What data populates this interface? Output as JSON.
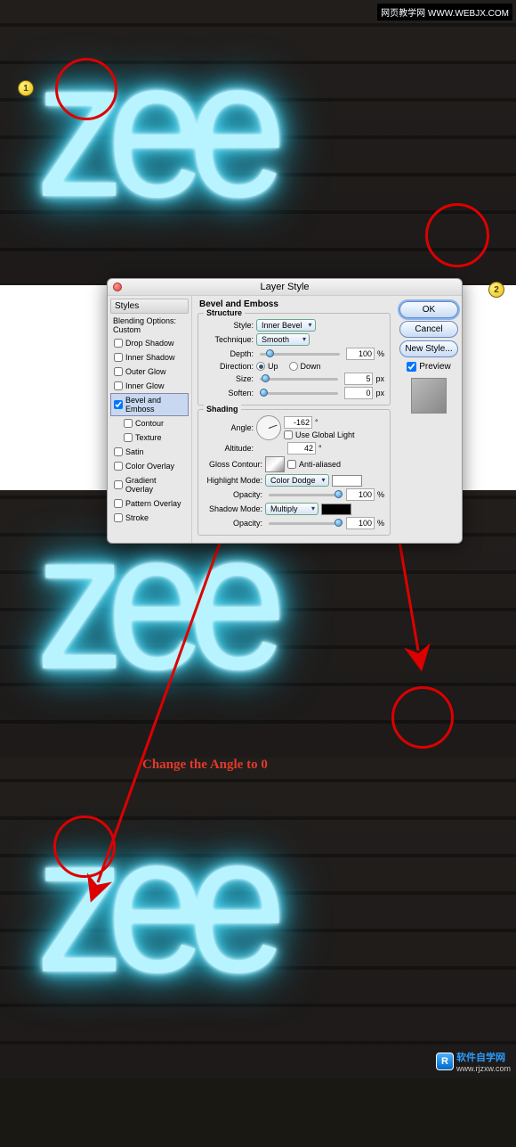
{
  "watermarks": {
    "top": "网页教学网\nWWW.WEBJX.COM",
    "bottom_cn": "软件自学网",
    "bottom_url": "www.rjzxw.com",
    "bottom_logo": "R"
  },
  "neon": "zee",
  "badges": {
    "one": "1",
    "two": "2"
  },
  "annotation": "Change the Angle to 0",
  "dialog": {
    "title": "Layer Style",
    "buttons": {
      "ok": "OK",
      "cancel": "Cancel",
      "new_style": "New Style...",
      "preview": "Preview"
    },
    "styles_head": "Styles",
    "blending_opts": "Blending Options: Custom",
    "style_list": [
      {
        "label": "Drop Shadow",
        "checked": false
      },
      {
        "label": "Inner Shadow",
        "checked": false
      },
      {
        "label": "Outer Glow",
        "checked": false
      },
      {
        "label": "Inner Glow",
        "checked": false
      },
      {
        "label": "Bevel and Emboss",
        "checked": true,
        "active": true
      },
      {
        "label": "Contour",
        "checked": false,
        "sub": true
      },
      {
        "label": "Texture",
        "checked": false,
        "sub": true
      },
      {
        "label": "Satin",
        "checked": false
      },
      {
        "label": "Color Overlay",
        "checked": false
      },
      {
        "label": "Gradient Overlay",
        "checked": false
      },
      {
        "label": "Pattern Overlay",
        "checked": false
      },
      {
        "label": "Stroke",
        "checked": false
      }
    ],
    "main_title": "Bevel and Emboss",
    "groups": {
      "structure": {
        "title": "Structure",
        "style_label": "Style:",
        "style_val": "Inner Bevel",
        "technique_label": "Technique:",
        "technique_val": "Smooth",
        "depth_label": "Depth:",
        "depth_val": "100",
        "depth_unit": "%",
        "direction_label": "Direction:",
        "up": "Up",
        "down": "Down",
        "size_label": "Size:",
        "size_val": "5",
        "size_unit": "px",
        "soften_label": "Soften:",
        "soften_val": "0",
        "soften_unit": "px"
      },
      "shading": {
        "title": "Shading",
        "angle_label": "Angle:",
        "angle_val": "-162",
        "deg": "°",
        "global_light": "Use Global Light",
        "altitude_label": "Altitude:",
        "altitude_val": "42",
        "gloss_label": "Gloss Contour:",
        "anti_alias": "Anti-aliased",
        "hl_mode_label": "Highlight Mode:",
        "hl_mode_val": "Color Dodge",
        "hl_opacity_label": "Opacity:",
        "hl_opacity_val": "100",
        "pct": "%",
        "sh_mode_label": "Shadow Mode:",
        "sh_mode_val": "Multiply",
        "sh_opacity_label": "Opacity:",
        "sh_opacity_val": "100"
      }
    }
  }
}
